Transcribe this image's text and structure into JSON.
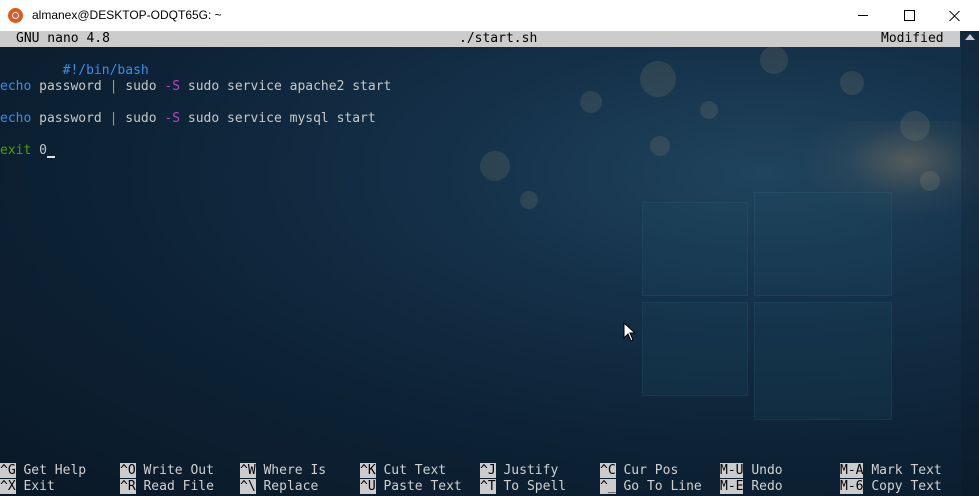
{
  "window": {
    "title": "almanex@DESKTOP-ODQT65G: ~"
  },
  "nano_header": {
    "version": "GNU nano 4.8",
    "filename": "./start.sh",
    "status": "Modified"
  },
  "code": {
    "line1": "#!/bin/bash",
    "line3": {
      "cmd": "echo",
      "arg": " password ",
      "pipe": "|",
      "sudo": " sudo ",
      "flag": "-S",
      "rest": " sudo service apache2 start"
    },
    "line5": {
      "cmd": "echo",
      "arg": " password ",
      "pipe": "|",
      "sudo": " sudo ",
      "flag": "-S",
      "rest": " sudo service mysql start"
    },
    "line7": {
      "cmd": "exit",
      "arg": " 0"
    }
  },
  "shortcuts": [
    {
      "key": "^G",
      "label": "Get Help"
    },
    {
      "key": "^O",
      "label": "Write Out"
    },
    {
      "key": "^W",
      "label": "Where Is"
    },
    {
      "key": "^K",
      "label": "Cut Text"
    },
    {
      "key": "^J",
      "label": "Justify"
    },
    {
      "key": "^C",
      "label": "Cur Pos"
    },
    {
      "key": "M-U",
      "label": "Undo"
    },
    {
      "key": "M-A",
      "label": "Mark Text"
    },
    {
      "key": "^X",
      "label": "Exit"
    },
    {
      "key": "^R",
      "label": "Read File"
    },
    {
      "key": "^\\",
      "label": "Replace"
    },
    {
      "key": "^U",
      "label": "Paste Text"
    },
    {
      "key": "^T",
      "label": "To Spell"
    },
    {
      "key": "^_",
      "label": "Go To Line"
    },
    {
      "key": "M-E",
      "label": "Redo"
    },
    {
      "key": "M-6",
      "label": "Copy Text"
    }
  ],
  "colors": {
    "titlebar": "#ffffff",
    "header_bg": "#cccccc",
    "keyword": "#3a8ee6",
    "pipe": "#c4a000",
    "flag": "#b148c6",
    "exit": "#4e9a06"
  },
  "icons": [
    "ubuntu-icon",
    "minimize-icon",
    "maximize-icon",
    "close-icon",
    "mouse-pointer-icon"
  ]
}
